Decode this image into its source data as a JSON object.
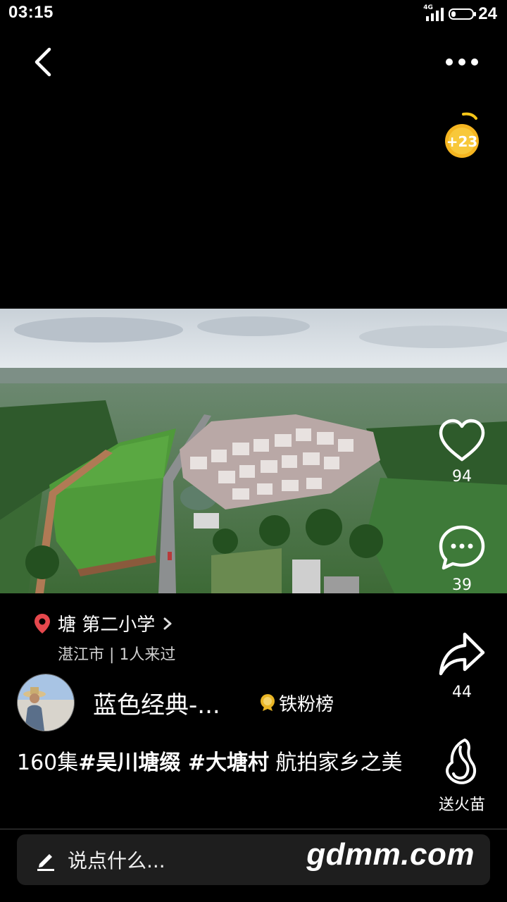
{
  "status": {
    "time": "03:15",
    "network": "4G",
    "battery": "24"
  },
  "coin": {
    "label": "+23"
  },
  "video": {
    "type": "aerial-village-photo"
  },
  "actions": {
    "like_count": "94",
    "comment_count": "39",
    "share_count": "44",
    "gift_label": "送火苗"
  },
  "location": {
    "title": "塘 第二小学",
    "sub": "湛江市 | 1人来过"
  },
  "author": {
    "name": "蓝色经典-...",
    "fans_label": "铁粉榜"
  },
  "caption": {
    "prefix": "160集",
    "tag1": "#吴川塘缀",
    "tag2": " #大塘村",
    "suffix": " 航拍家乡之美"
  },
  "input": {
    "placeholder": "说点什么..."
  },
  "watermark": "gdmm.com",
  "colors": {
    "background": "#000000",
    "location_pin": "#e5484d",
    "coin": "#f5b520",
    "badge": "#e9b525"
  }
}
